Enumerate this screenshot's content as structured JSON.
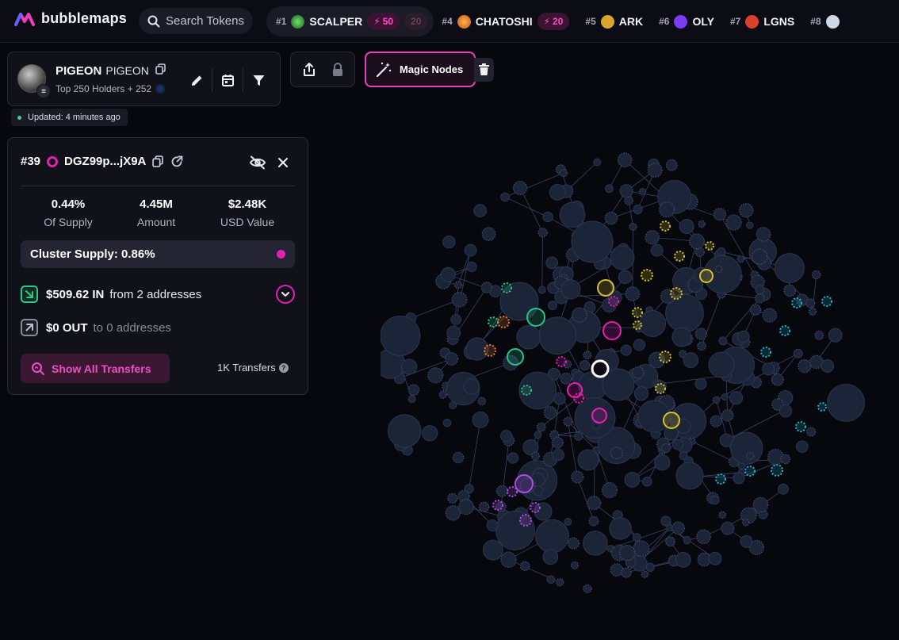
{
  "app": {
    "name": "bubblemaps"
  },
  "search": {
    "placeholder": "Search Tokens"
  },
  "ticker": [
    {
      "rank": "#1",
      "name": "SCALPER",
      "boost": "50",
      "boost2": "20"
    },
    {
      "rank": "#4",
      "name": "CHATOSHI",
      "boost": "20"
    },
    {
      "rank": "#5",
      "name": "ARK"
    },
    {
      "rank": "#6",
      "name": "OLY"
    },
    {
      "rank": "#7",
      "name": "LGNS"
    },
    {
      "rank": "#8"
    }
  ],
  "token": {
    "symbol": "PIGEON",
    "name": "PIGEON",
    "subtitle": "Top 250 Holders + 252",
    "updated": "Updated: 4 minutes ago"
  },
  "toolbar": {
    "magic_label": "Magic Nodes"
  },
  "wallet": {
    "rank": "#39",
    "address": "DGZ99p...jX9A",
    "stats": [
      {
        "value": "0.44%",
        "label": "Of Supply"
      },
      {
        "value": "4.45M",
        "label": "Amount"
      },
      {
        "value": "$2.48K",
        "label": "USD Value"
      }
    ],
    "cluster": "Cluster Supply: 0.86%",
    "in_amount": "$509.62 IN",
    "in_text": "from 2 addresses",
    "out_amount": "$0 OUT",
    "out_text": "to 0 addresses",
    "show_button": "Show All Transfers",
    "transfers": "1K Transfers"
  },
  "colors": {
    "accent": "#e41fb3",
    "cluster_yellow": "#d9c12b",
    "cluster_green": "#27c48a",
    "cluster_orange": "#e87b2a",
    "cluster_cyan": "#1fb3c8",
    "cluster_purple": "#b04ee8",
    "bubble": "#1c2438"
  }
}
